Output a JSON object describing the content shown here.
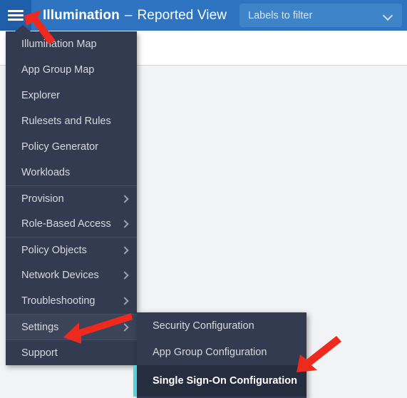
{
  "header": {
    "menu_icon": "hamburger-icon",
    "brand_title": "Illumination",
    "brand_dash": "–",
    "brand_view": "Reported View",
    "labels_filter": {
      "placeholder": "Labels to filter",
      "value": "Labels to filter",
      "chevron": "chevron-down-icon"
    },
    "accent_color": "#2f74c0",
    "menu_button_color": "#1f5ea8"
  },
  "menu": {
    "panel_color": "#333b50",
    "hover_color": "#3b4459",
    "items": [
      {
        "label": "Illumination Map",
        "has_submenu": false,
        "group_start": false,
        "hovered": false
      },
      {
        "label": "App Group Map",
        "has_submenu": false,
        "group_start": false,
        "hovered": false
      },
      {
        "label": "Explorer",
        "has_submenu": false,
        "group_start": false,
        "hovered": false
      },
      {
        "label": "Rulesets and Rules",
        "has_submenu": false,
        "group_start": false,
        "hovered": false
      },
      {
        "label": "Policy Generator",
        "has_submenu": false,
        "group_start": false,
        "hovered": false
      },
      {
        "label": "Workloads",
        "has_submenu": false,
        "group_start": false,
        "hovered": false
      },
      {
        "label": "Provision",
        "has_submenu": true,
        "group_start": true,
        "hovered": false
      },
      {
        "label": "Role-Based Access",
        "has_submenu": true,
        "group_start": false,
        "hovered": false
      },
      {
        "label": "Policy Objects",
        "has_submenu": true,
        "group_start": true,
        "hovered": false
      },
      {
        "label": "Network Devices",
        "has_submenu": true,
        "group_start": false,
        "hovered": false
      },
      {
        "label": "Troubleshooting",
        "has_submenu": true,
        "group_start": false,
        "hovered": false
      },
      {
        "label": "Settings",
        "has_submenu": true,
        "group_start": true,
        "hovered": true
      },
      {
        "label": "Support",
        "has_submenu": false,
        "group_start": true,
        "hovered": false
      }
    ]
  },
  "submenu": {
    "parent": "Settings",
    "selected_accent_color": "#4fd4e0",
    "selected_row_color": "#262d3e",
    "items": [
      {
        "label": "Security Configuration",
        "selected": false
      },
      {
        "label": "App Group Configuration",
        "selected": false
      },
      {
        "label": "Single Sign-On Configuration",
        "selected": true
      }
    ]
  },
  "annotations": {
    "color": "#ee2a1e",
    "arrows": [
      {
        "name": "arrow-to-hamburger-menu",
        "points_at": "hamburger-icon"
      },
      {
        "name": "arrow-to-settings",
        "points_at": "Settings"
      },
      {
        "name": "arrow-to-sso",
        "points_at": "Single Sign-On Configuration"
      }
    ]
  }
}
